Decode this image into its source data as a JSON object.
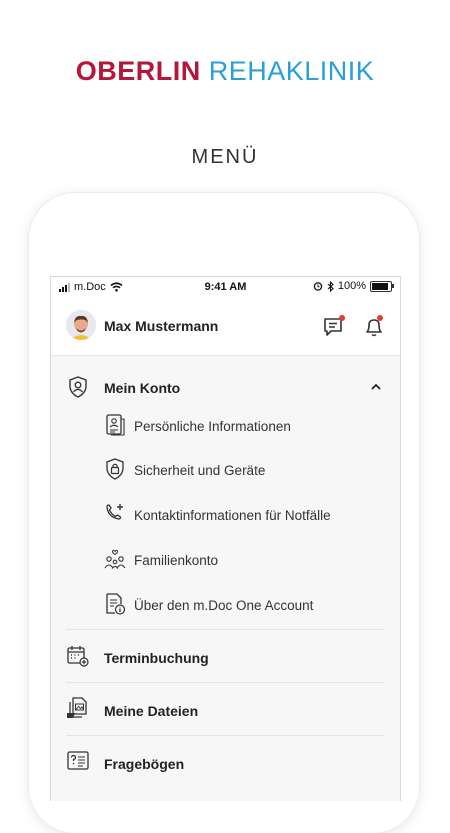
{
  "brand": {
    "part1": "OBERLIN",
    "part2": "REHAKLINIK"
  },
  "page_heading": "MENÜ",
  "status_bar": {
    "carrier": "m.Doc",
    "time": "9:41 AM",
    "battery": "100%",
    "battery_level": 1.0
  },
  "header": {
    "user_name": "Max Mustermann",
    "messages_icon": "chat-icon",
    "notifications_icon": "bell-icon"
  },
  "menu": {
    "account": {
      "label": "Mein Konto",
      "icon": "shield-user-icon",
      "expanded": true,
      "items": [
        {
          "label": "Persönliche Informationen",
          "icon": "id-card-icon"
        },
        {
          "label": "Sicherheit und Geräte",
          "icon": "shield-lock-icon"
        },
        {
          "label": "Kontaktinformationen für Notfälle",
          "icon": "phone-plus-icon"
        },
        {
          "label": "Familienkonto",
          "icon": "family-icon"
        },
        {
          "label": "Über den m.Doc One Account",
          "icon": "document-info-icon"
        }
      ]
    },
    "items": [
      {
        "label": "Terminbuchung",
        "icon": "calendar-plus-icon"
      },
      {
        "label": "Meine Dateien",
        "icon": "files-icon"
      },
      {
        "label": "Fragebögen",
        "icon": "questionnaire-icon"
      }
    ]
  },
  "colors": {
    "brand_red": "#b5173a",
    "brand_blue": "#2a9fd8",
    "badge_red": "#e53935"
  }
}
